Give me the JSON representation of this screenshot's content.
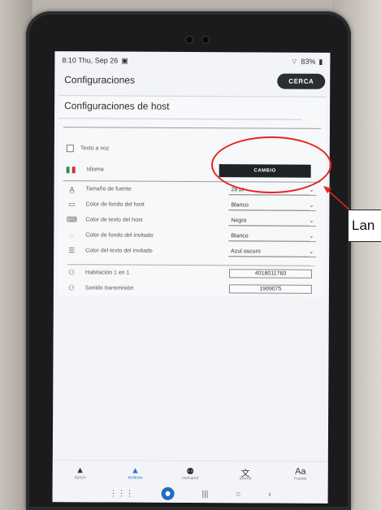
{
  "status": {
    "time_date": "8:10  Thu, Sep 26",
    "battery": "83%"
  },
  "header": {
    "title": "Configuraciones",
    "close_label": "CERCA"
  },
  "section": {
    "title": "Configuraciones de host"
  },
  "voice_text": {
    "label": "Texto a voz"
  },
  "language": {
    "label": "Idioma",
    "button_label": "CAMBIO"
  },
  "settings": [
    {
      "icon": "font-size-icon",
      "label": "Tamaño de fuente",
      "value": "28 pt"
    },
    {
      "icon": "background-color-icon",
      "label": "Color de fondo del host",
      "value": "Blanco"
    },
    {
      "icon": "text-color-icon",
      "label": "Color de texto del host",
      "value": "Negro"
    },
    {
      "icon": "guest-background-icon",
      "label": "Color de fondo del invitado",
      "value": "Blanco"
    },
    {
      "icon": "guest-text-icon",
      "label": "Color del texto del invitado",
      "value": "Azul oscuro"
    }
  ],
  "info": [
    {
      "label": "Habitación 1 en 1",
      "value": "4018011760"
    },
    {
      "label": "Sonido transmisión",
      "value": "1969075"
    }
  ],
  "nav": [
    {
      "label": "Apoyo",
      "icon": "person-icon",
      "active": false
    },
    {
      "label": "Anfitrión",
      "icon": "host-icon",
      "active": true
    },
    {
      "label": "Huésped",
      "icon": "guests-icon",
      "active": false
    },
    {
      "label": "Idioma",
      "icon": "translate-icon",
      "active": false
    },
    {
      "label": "Fuente",
      "icon": "font-icon",
      "active": false
    }
  ],
  "annotation": {
    "callout_text": "Lan",
    "color": "#e8231f"
  },
  "colors": {
    "accent": "#2b76d6",
    "button_dark": "#1f2328",
    "highlight": "#e8231f"
  }
}
